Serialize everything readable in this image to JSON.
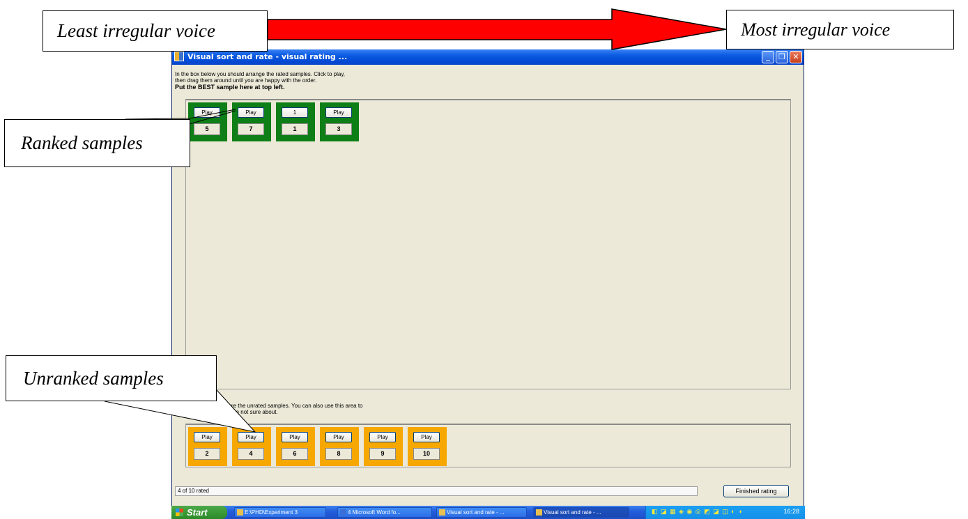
{
  "annotations": {
    "least": "Least irregular voice",
    "most": "Most irregular voice",
    "ranked": "Ranked samples",
    "unranked": "Unranked samples",
    "arrow_color": "#ff0000"
  },
  "window": {
    "title": "Visual sort and rate - visual rating ...",
    "controls": [
      "minimize-icon",
      "maximize-icon",
      "close-icon"
    ],
    "instructions": [
      "In the box below you should arrange the rated samples. Click to play,",
      "then drag them around until you are happy with the order.",
      "Put the BEST sample here at top left."
    ],
    "unrated_instructions": [
      "In the box below are the unrated samples. You can also use this area to",
      "hold samples you are not sure about."
    ]
  },
  "ranked": [
    {
      "button": "Play",
      "number": "5"
    },
    {
      "button": "Play",
      "number": "7"
    },
    {
      "button": "1",
      "number": "1"
    },
    {
      "button": "Play",
      "number": "3"
    }
  ],
  "unranked": [
    {
      "button": "Play",
      "number": "2"
    },
    {
      "button": "Play",
      "number": "4"
    },
    {
      "button": "Play",
      "number": "6"
    },
    {
      "button": "Play",
      "number": "8"
    },
    {
      "button": "Play",
      "number": "9"
    },
    {
      "button": "Play",
      "number": "10"
    }
  ],
  "status": "4 of 10 rated",
  "finish_label": "Finished rating",
  "colors": {
    "ranked_card": "#0e7f16",
    "unranked_card": "#f6a700"
  },
  "taskbar": {
    "start": "Start",
    "tasks": [
      "E:\\PHD\\Experiment 3",
      "4 Microsoft Word fo...",
      "Visual sort and rate - ...",
      "Visual sort and rate - ..."
    ],
    "clock": "16:28"
  }
}
